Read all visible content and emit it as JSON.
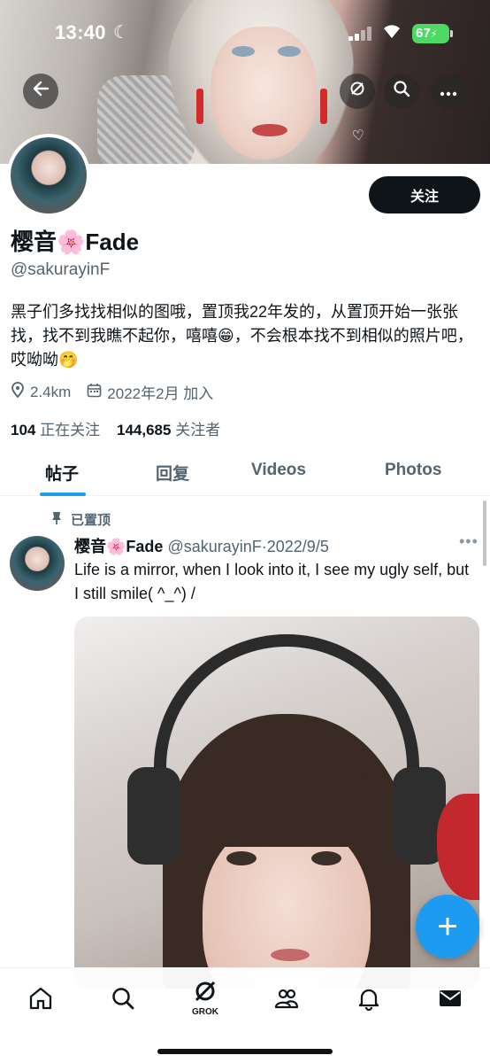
{
  "status_bar": {
    "time": "13:40",
    "battery": "67"
  },
  "profile": {
    "display_name": "樱音🌸Fade",
    "handle": "@sakurayinF",
    "bio": "黑子们多找找相似的图哦，置顶我22年发的，从置顶开始一张张找，找不到我瞧不起你，嘻嘻😁，不会根本找不到相似的照片吧，哎呦呦🤭",
    "location": "2.4km",
    "joined": "2022年2月 加入",
    "following_count": "104",
    "following_label": "正在关注",
    "followers_count": "144,685",
    "followers_label": "关注者",
    "follow_button": "关注"
  },
  "tabs": [
    {
      "label": "帖子",
      "active": true
    },
    {
      "label": "回复",
      "active": false
    },
    {
      "label": "Videos",
      "active": false
    },
    {
      "label": "Photos",
      "active": false
    }
  ],
  "pinned_post": {
    "pinned_label": "已置顶",
    "author_name": "樱音🌸Fade",
    "author_handle": "@sakurayinF",
    "date": "2022/9/5",
    "text": "Life is a mirror, when I look into it, I see my ugly self, but I still smile( ^_^) /"
  },
  "bottom_nav": {
    "grok_label": "GROK"
  },
  "colors": {
    "accent": "#1d9bf0",
    "text": "#0f1419",
    "muted": "#536471"
  },
  "icons": [
    "back-arrow-icon",
    "grok-icon",
    "search-icon",
    "more-icon",
    "location-icon",
    "calendar-icon",
    "pin-icon",
    "home-icon",
    "people-icon",
    "bell-icon",
    "mail-icon",
    "compose-plus-icon"
  ]
}
